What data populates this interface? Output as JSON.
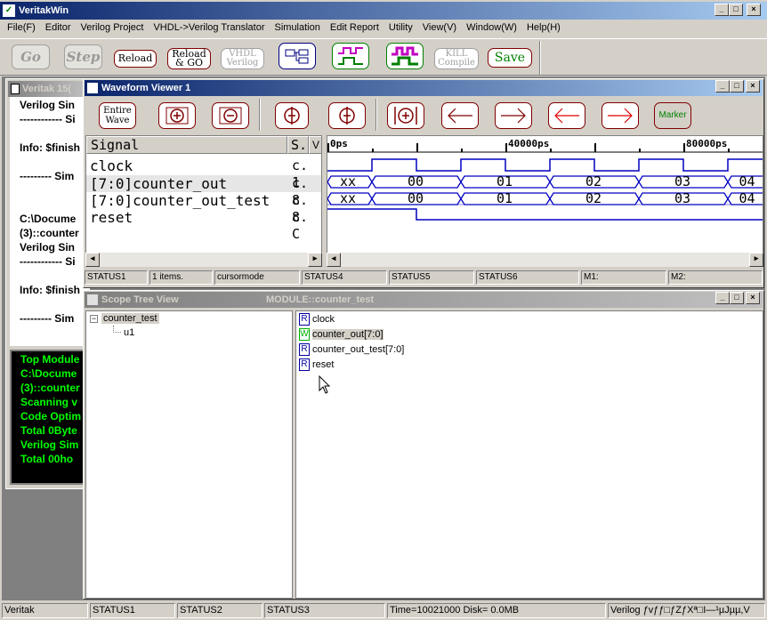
{
  "app": {
    "title": "VeritakWin",
    "menu": [
      "File(F)",
      "Editor",
      "Verilog Project",
      "VHDL->Verilog Translator",
      "Simulation",
      "Edit Report",
      "Utility",
      "View(V)",
      "Window(W)",
      "Help(H)"
    ]
  },
  "toolbar": {
    "go": "Go",
    "step": "Step",
    "reload": "Reload",
    "reload_go": "Reload & GO",
    "vhdl_verilog": "VHDL Verilog",
    "kill_compile": "KILL Compile",
    "save": "Save"
  },
  "console_window": {
    "title": "Veritak 15(",
    "lines": [
      "Verilog Sin",
      "------------ Si",
      "Info: $finish",
      "--------- Sim",
      "C:\\Docume",
      "(3)::counter",
      "Verilog Sin",
      "------------ Si",
      "Info: $finish",
      "--------- Sim"
    ]
  },
  "green_console": {
    "lines": [
      "Top Module",
      "C:\\Docume",
      "(3)::counter",
      "Scanning v",
      "Code Optim",
      "Total 0Byte",
      "Verilog Sim",
      "Total  00ho"
    ]
  },
  "waveform": {
    "title": "Waveform Viewer 1",
    "entire_wave": "Entire Wave",
    "marker": "Marker",
    "signal_header": "Signal",
    "s_header": "S.",
    "v_header": "V",
    "time_labels": [
      "0ps",
      "40000ps",
      "80000ps"
    ],
    "signals": [
      {
        "name": "clock",
        "c": "c. 1"
      },
      {
        "name": "[7:0]counter_out",
        "c": "c. 8"
      },
      {
        "name": "[7:0]counter_out_test",
        "c": "c. 8"
      },
      {
        "name": "reset",
        "c": "c. C"
      }
    ],
    "bus_values": [
      "xx",
      "00",
      "01",
      "02",
      "03",
      "04"
    ],
    "status": [
      "STATUS1",
      "1 items.",
      "cursormode",
      "STATUS4",
      "STATUS5",
      "STATUS6",
      "M1:",
      "M2:"
    ]
  },
  "scope": {
    "title": "Scope Tree View",
    "module": "MODULE::counter_test",
    "tree_root": "counter_test",
    "tree_child": "u1",
    "ports": [
      {
        "badge": "R",
        "name": "clock"
      },
      {
        "badge": "W",
        "name": "counter_out[7:0]"
      },
      {
        "badge": "R",
        "name": "counter_out_test[7:0]"
      },
      {
        "badge": "R",
        "name": "reset"
      }
    ]
  },
  "statusbar": {
    "app": "Veritak",
    "s1": "STATUS1",
    "s2": "STATUS2",
    "s3": "STATUS3",
    "time": "Time=10021000 Disk=  0.0MB",
    "right": "Verilog ƒvƒƒ□ƒZƒXª□I—¹µJµµ,V"
  },
  "colors": {
    "wave": "#0000c0",
    "green": "#00ff00",
    "title_active": "#0a246a"
  }
}
